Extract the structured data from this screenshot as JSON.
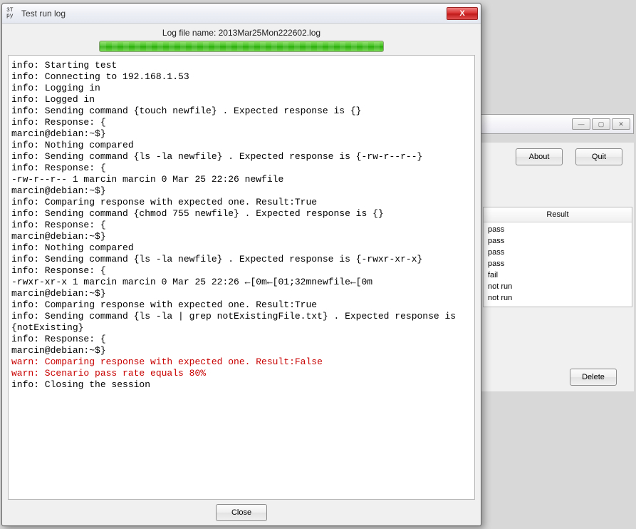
{
  "dialog": {
    "app_icon_text": "3T\npy",
    "title": "Test run log",
    "log_filename_label": "Log file name: 2013Mar25Mon222602.log",
    "close_label": "Close",
    "close_x": "X",
    "log_lines": [
      {
        "cls": "log-line",
        "text": "info: Starting test"
      },
      {
        "cls": "log-line",
        "text": "info: Connecting to 192.168.1.53"
      },
      {
        "cls": "log-line",
        "text": "info: Logging in"
      },
      {
        "cls": "log-line",
        "text": "info: Logged in"
      },
      {
        "cls": "log-line",
        "text": "info: Sending command {touch newfile} . Expected response is {}"
      },
      {
        "cls": "log-line",
        "text": "info: Response: {"
      },
      {
        "cls": "log-line",
        "text": "marcin@debian:~$}"
      },
      {
        "cls": "log-line",
        "text": "info: Nothing compared"
      },
      {
        "cls": "log-line",
        "text": "info: Sending command {ls -la newfile} . Expected response is {-rw-r--r--}"
      },
      {
        "cls": "log-line",
        "text": "info: Response: {"
      },
      {
        "cls": "log-line",
        "text": "-rw-r--r-- 1 marcin marcin 0 Mar 25 22:26 newfile"
      },
      {
        "cls": "log-line",
        "text": "marcin@debian:~$}"
      },
      {
        "cls": "log-line",
        "text": "info: Comparing response with expected one. Result:True"
      },
      {
        "cls": "log-line",
        "text": "info: Sending command {chmod 755 newfile} . Expected response is {}"
      },
      {
        "cls": "log-line",
        "text": "info: Response: {"
      },
      {
        "cls": "log-line",
        "text": "marcin@debian:~$}"
      },
      {
        "cls": "log-line",
        "text": "info: Nothing compared"
      },
      {
        "cls": "log-line",
        "text": "info: Sending command {ls -la newfile} . Expected response is {-rwxr-xr-x}"
      },
      {
        "cls": "log-line",
        "text": "info: Response: {"
      },
      {
        "cls": "log-line",
        "text": "-rwxr-xr-x 1 marcin marcin 0 Mar 25 22:26 ←[0m←[01;32mnewfile←[0m"
      },
      {
        "cls": "log-line",
        "text": "marcin@debian:~$}"
      },
      {
        "cls": "log-line",
        "text": "info: Comparing response with expected one. Result:True"
      },
      {
        "cls": "log-line",
        "text": "info: Sending command {ls -la | grep notExistingFile.txt} . Expected response is {notExisting}"
      },
      {
        "cls": "log-line",
        "text": "info: Response: {"
      },
      {
        "cls": "log-line",
        "text": "marcin@debian:~$}"
      },
      {
        "cls": "log-warn",
        "text": "warn: Comparing response with expected one. Result:False"
      },
      {
        "cls": "log-warn",
        "text": "warn: Scenario pass rate equals 80%"
      },
      {
        "cls": "log-line",
        "text": "info: Closing the session"
      }
    ]
  },
  "bg": {
    "about_label": "About",
    "quit_label": "Quit",
    "result_header": "Result",
    "delete_label": "Delete",
    "results": [
      "pass",
      "pass",
      "pass",
      "pass",
      "fail",
      "not run",
      "not run"
    ],
    "controls": {
      "min": "—",
      "max": "▢",
      "close": "✕"
    }
  }
}
